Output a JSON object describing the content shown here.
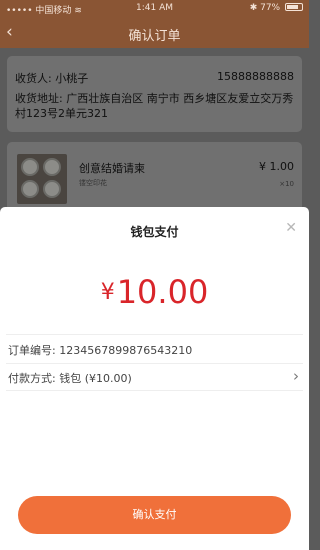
{
  "status_bar": {
    "carrier": "中国移动",
    "wifi_icon": "wifi-icon",
    "time": "1:41 AM",
    "bluetooth_icon": "bluetooth-icon",
    "battery": "77%"
  },
  "nav": {
    "title": "确认订单",
    "back_icon": "chevron-left-icon"
  },
  "address": {
    "name_label": "收货人:",
    "name": "小桃子",
    "phone": "15888888888",
    "address_label": "收货地址:",
    "address": "广西壮族自治区 南宁市 西乡塘区友爱立交万秀村123号2单元321"
  },
  "product": {
    "name": "创意结婚请柬",
    "subtitle": "镂空印花",
    "price": "¥ 1.00",
    "quantity": "×10"
  },
  "payment_sheet": {
    "title": "钱包支付",
    "close_icon": "close-icon",
    "currency_symbol": "¥",
    "amount": "10.00",
    "order_no_label": "订单编号:",
    "order_no": "1234567899876543210",
    "pay_method_label": "付款方式:",
    "pay_method": "钱包 (¥10.00)",
    "confirm_button": "确认支付"
  },
  "colors": {
    "accent": "#f0703a",
    "amount": "#d9252a",
    "overlay_header": "#8a5534"
  }
}
